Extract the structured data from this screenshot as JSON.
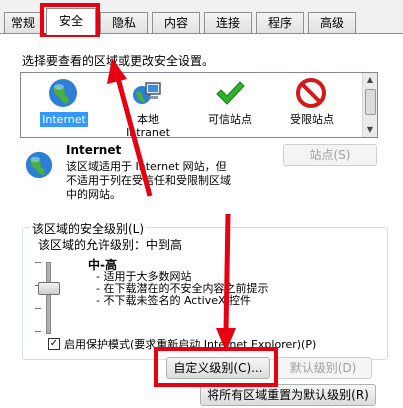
{
  "tabs": [
    "常规",
    "安全",
    "隐私",
    "内容",
    "连接",
    "程序",
    "高级"
  ],
  "instruction": "选择要查看的区域或更改安全设置。",
  "zones": [
    {
      "label": "Internet",
      "icon": "globe-icon"
    },
    {
      "label": "本地\nIntranet",
      "icon": "intranet-icon"
    },
    {
      "label": "可信站点",
      "icon": "checkmark-icon"
    },
    {
      "label": "受限站点",
      "icon": "restricted-icon"
    }
  ],
  "zone_info": {
    "title": "Internet",
    "desc_lines": [
      "该区域适用于 Internet 网站，但",
      "不适用于列在受信任和受限制区域",
      "中的网站。"
    ],
    "sites_button": "站点(S)"
  },
  "security_group": {
    "title": "该区域的安全级别(L)",
    "allowed_levels": "该区域的允许级别：中到高",
    "level_name": "中-高",
    "bullets": [
      "- 适用于大多数网站",
      "- 在下载潜在的不安全内容之前提示",
      "- 不下载未签名的 ActiveX 控件"
    ],
    "slider_level": 0.35,
    "protected_mode": "启用保护模式(要求重新启动 Internet Explorer)(P)",
    "protected_mode_checked": true,
    "custom_button": "自定义级别(C)...",
    "default_button": "默认级别(D)"
  },
  "reset_button": "将所有区域重置为默认级别(R)",
  "colors": {
    "annotation": "#e60012",
    "selection": "#3399ff"
  }
}
